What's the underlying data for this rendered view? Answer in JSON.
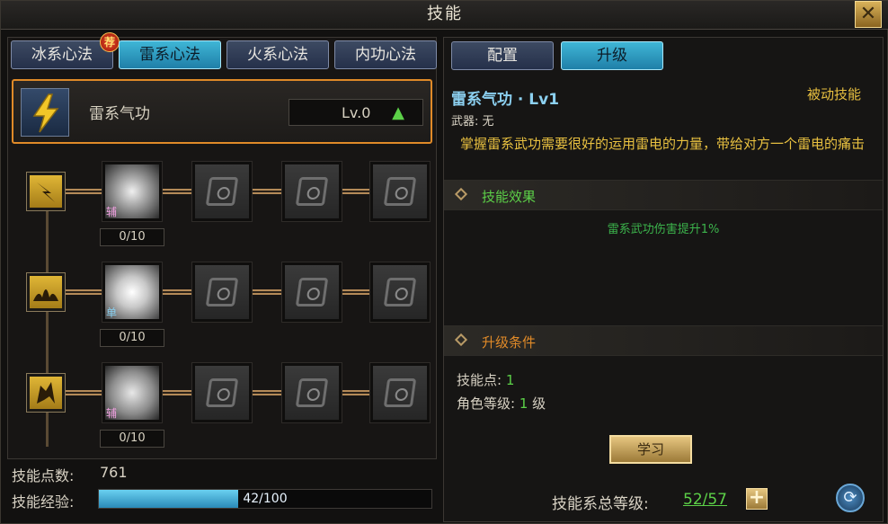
{
  "window": {
    "title": "技能",
    "close_glyph": "✕"
  },
  "left": {
    "tabs": [
      {
        "label": "冰系心法",
        "badge": "荐"
      },
      {
        "label": "雷系心法"
      },
      {
        "label": "火系心法"
      },
      {
        "label": "内功心法"
      }
    ],
    "active_tab_index": 1,
    "header": {
      "name": "雷系气功",
      "level": "Lv.0",
      "icon": "lightning-icon"
    },
    "rows": [
      {
        "icon": "lightning-rune-icon",
        "first_slot_tag": "辅",
        "progress": "0/10"
      },
      {
        "icon": "lotus-rune-icon",
        "first_slot_tag": "单",
        "progress": "0/10"
      },
      {
        "icon": "figure-rune-icon",
        "first_slot_tag": "辅",
        "progress": "0/10"
      }
    ],
    "footer": {
      "points_label": "技能点数:",
      "points_value": "761",
      "exp_label": "技能经验:",
      "exp_text": "42/100",
      "exp_fraction": 0.42
    }
  },
  "right": {
    "tabs": [
      {
        "label": "配置"
      },
      {
        "label": "升级"
      }
    ],
    "active_tab_index": 1,
    "detail_title": "雷系气功 · Lv1",
    "detail_type": "被动技能",
    "weapon": "武器: 无",
    "description": "掌握雷系武功需要很好的运用雷电的力量，带给对方一个雷电的痛击",
    "effect_section_label": "技能效果",
    "effect_text": "雷系武功伤害提升1%",
    "condition_section_label": "升级条件",
    "cond_points_label": "技能点:",
    "cond_points_value": "1",
    "cond_level_label": "角色等级:",
    "cond_level_value": "1",
    "cond_level_unit": "级",
    "learn_button": "学习",
    "total_label": "技能系总等级:",
    "total_value": "52/57",
    "plus_glyph": "+",
    "refresh_glyph": "⟳"
  },
  "colors": {
    "accent_blue": "#3fb6d6",
    "accent_gold": "#e8c040",
    "accent_orange": "#e08a28",
    "positive_green": "#5cd048"
  }
}
